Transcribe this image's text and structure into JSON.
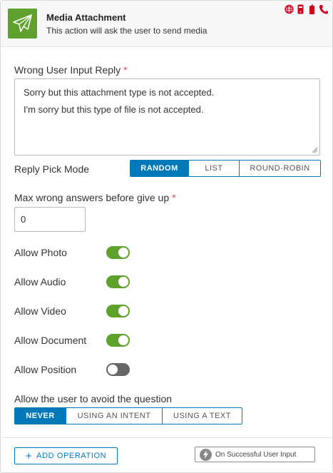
{
  "header": {
    "title": "Media Attachment",
    "subtitle": "This action will ask the user to send media",
    "icon": "paper-plane-icon",
    "icon_bg": "#5fa12d",
    "channel_icons": [
      "globe-icon",
      "mobile-icon",
      "smartphone-icon",
      "phone-icon"
    ],
    "channel_color": "#d0021b"
  },
  "wrong_reply": {
    "label": "Wrong User Input Reply",
    "required_mark": "*",
    "lines": [
      "Sorry but this attachment type is not accepted.",
      "I'm sorry but this type of file is not accepted."
    ]
  },
  "pick_mode": {
    "label": "Reply Pick Mode",
    "options": [
      "RANDOM",
      "LIST",
      "ROUND-ROBIN"
    ],
    "selected": "RANDOM"
  },
  "max_wrong": {
    "label": "Max wrong answers before give up",
    "required_mark": "*",
    "value": "0"
  },
  "toggles": [
    {
      "label": "Allow Photo",
      "on": true
    },
    {
      "label": "Allow Audio",
      "on": true
    },
    {
      "label": "Allow Video",
      "on": true
    },
    {
      "label": "Allow Document",
      "on": true
    },
    {
      "label": "Allow Position",
      "on": false
    }
  ],
  "avoid": {
    "label": "Allow the user to avoid the question",
    "options": [
      "NEVER",
      "USING AN INTENT",
      "USING A TEXT"
    ],
    "selected": "NEVER"
  },
  "footer": {
    "add_operation": "ADD OPERATION",
    "event_label": "On Successful User Input"
  },
  "colors": {
    "accent": "#0079b8",
    "toggle_on": "#5fa12d",
    "toggle_off": "#666666",
    "required": "#e14d3b"
  }
}
